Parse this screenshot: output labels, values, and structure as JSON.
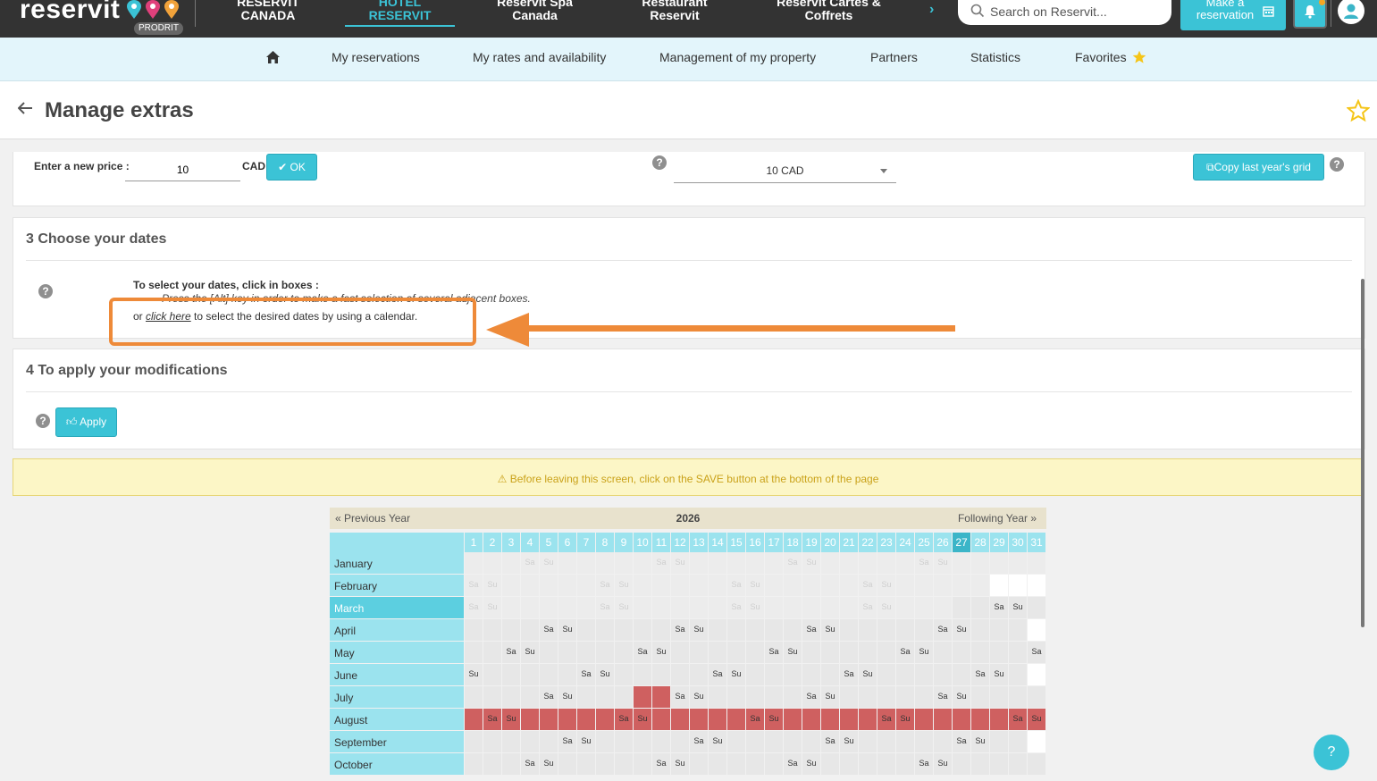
{
  "brand": {
    "logo": "reservit",
    "badge": "PRODRIT"
  },
  "topnav": [
    {
      "line1": "RESERVIT",
      "line2": "CANADA"
    },
    {
      "line1": "HOTEL",
      "line2": "RESERVIT"
    },
    {
      "line1": "Reservit Spa",
      "line2": "Canada"
    },
    {
      "line1": "Restaurant",
      "line2": "Reservit"
    },
    {
      "line1": "Reservit Cartes &",
      "line2": "Coffrets"
    }
  ],
  "search": {
    "placeholder": "Search on Reservit..."
  },
  "make_reservation": {
    "line1": "Make a",
    "line2": "reservation"
  },
  "subnav": {
    "items": [
      "My reservations",
      "My rates and availability",
      "Management of my property",
      "Partners",
      "Statistics",
      "Favorites"
    ]
  },
  "page": {
    "title": "Manage extras"
  },
  "price": {
    "label": "Enter a new price :",
    "value": "10",
    "currency": "CAD",
    "ok_label": "OK",
    "select_value": "10 CAD",
    "copy_label": "Copy last year's grid"
  },
  "section3": {
    "title": "3 Choose your dates",
    "instr_bold": "To select your dates, click in boxes :",
    "instr_italic": "Press the [Alt] key in order to make a fast selection of several adjacent boxes.",
    "or": "or",
    "click_here": "click here",
    "calendar_text": "to select the desired dates by using a calendar."
  },
  "section4": {
    "title": "4 To apply your modifications",
    "apply_label": "Apply"
  },
  "warning": "Before leaving this screen, click on the SAVE button at the bottom of the page",
  "calendar": {
    "prev": "« Previous Year",
    "year": "2026",
    "next": "Following Year »",
    "days": [
      "1",
      "2",
      "3",
      "4",
      "5",
      "6",
      "7",
      "8",
      "9",
      "10",
      "11",
      "12",
      "13",
      "14",
      "15",
      "16",
      "17",
      "18",
      "19",
      "20",
      "21",
      "22",
      "23",
      "24",
      "25",
      "26",
      "27",
      "28",
      "29",
      "30",
      "31"
    ],
    "today_index": 26,
    "months": [
      {
        "name": "January",
        "days": 31,
        "first": 3,
        "faded_to": 31,
        "red": []
      },
      {
        "name": "February",
        "days": 28,
        "first": 6,
        "faded_to": 28,
        "red": []
      },
      {
        "name": "March",
        "days": 31,
        "first": 6,
        "faded_to": 26,
        "red": [],
        "selected": true
      },
      {
        "name": "April",
        "days": 30,
        "first": 2,
        "faded_to": 0,
        "red": []
      },
      {
        "name": "May",
        "days": 31,
        "first": 4,
        "faded_to": 0,
        "red": []
      },
      {
        "name": "June",
        "days": 30,
        "first": 0,
        "faded_to": 0,
        "red": []
      },
      {
        "name": "July",
        "days": 31,
        "first": 2,
        "faded_to": 0,
        "red": [
          10,
          11
        ]
      },
      {
        "name": "August",
        "days": 31,
        "first": 5,
        "faded_to": 0,
        "red": "all"
      },
      {
        "name": "September",
        "days": 30,
        "first": 1,
        "faded_to": 0,
        "red": []
      },
      {
        "name": "October",
        "days": 31,
        "first": 3,
        "faded_to": 0,
        "red": []
      }
    ],
    "sat": "Sa",
    "sun": "Su"
  },
  "colors": {
    "accent": "#3bc3d6",
    "highlight": "#ee8a39",
    "reserved": "#cf6060"
  }
}
